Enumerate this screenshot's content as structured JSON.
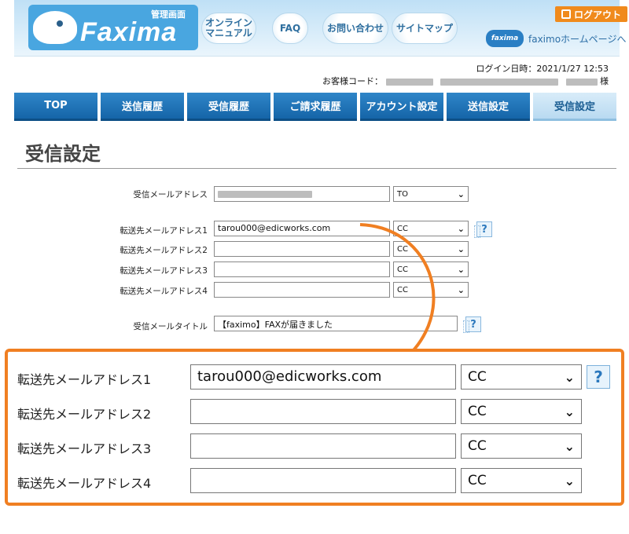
{
  "header": {
    "logo_title": "管理画面",
    "logo_name": "Faxima",
    "nav": [
      {
        "label": "オンライン\nマニュアル"
      },
      {
        "label": "FAQ"
      },
      {
        "label": "お問い合わせ"
      },
      {
        "label": "サイトマップ"
      }
    ],
    "logout_label": "ログアウト",
    "homepage_logo": "faxima",
    "homepage_label": "faximoホームページへ"
  },
  "login_info": {
    "login_datetime": "ログイン日時：2021/1/27  12:53",
    "customer_code_label": "お客様コード：",
    "honorific": "様"
  },
  "tabs": [
    {
      "label": "TOP",
      "active": false
    },
    {
      "label": "送信履歴",
      "active": false
    },
    {
      "label": "受信履歴",
      "active": false
    },
    {
      "label": "ご請求履歴",
      "active": false
    },
    {
      "label": "アカウント設定",
      "active": false
    },
    {
      "label": "送信設定",
      "active": false
    },
    {
      "label": "受信設定",
      "active": true
    }
  ],
  "page_title": "受信設定",
  "small_form": {
    "receive_email": {
      "label": "受信メールアドレス",
      "select": "TO"
    },
    "forward": [
      {
        "label": "転送先メールアドレス1",
        "value": "tarou000@edicworks.com",
        "select": "CC"
      },
      {
        "label": "転送先メールアドレス2",
        "value": "",
        "select": "CC"
      },
      {
        "label": "転送先メールアドレス3",
        "value": "",
        "select": "CC"
      },
      {
        "label": "転送先メールアドレス4",
        "value": "",
        "select": "CC"
      }
    ],
    "mail_title": {
      "label": "受信メールタイトル",
      "value": "【faximo】FAXが届きました"
    }
  },
  "zoom": {
    "forward": [
      {
        "label": "転送先メールアドレス1",
        "value": "tarou000@edicworks.com",
        "select": "CC"
      },
      {
        "label": "転送先メールアドレス2",
        "value": "",
        "select": "CC"
      },
      {
        "label": "転送先メールアドレス3",
        "value": "",
        "select": "CC"
      },
      {
        "label": "転送先メールアドレス4",
        "value": "",
        "select": "CC"
      }
    ]
  },
  "icons": {
    "help": "?",
    "chevron": "⌄"
  },
  "colors": {
    "accent": "#f07f22",
    "tab_blue": "#1f74b8"
  }
}
